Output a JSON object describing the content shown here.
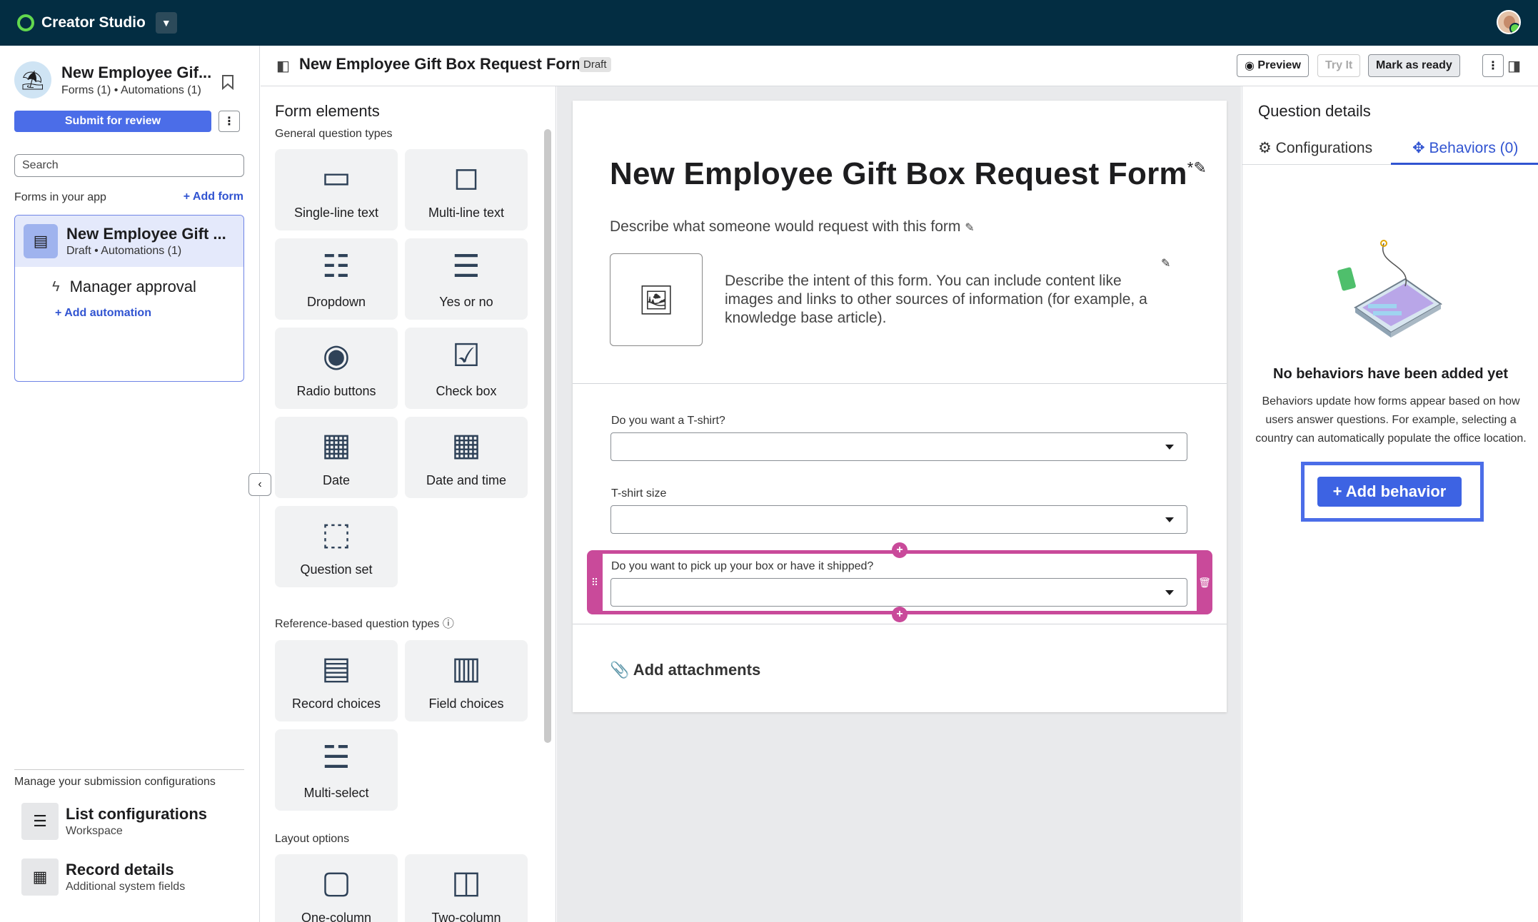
{
  "topbar": {
    "brand": "Creator Studio"
  },
  "app": {
    "title": "New Employee Gif...",
    "subtitle": "Forms (1) • Automations (1)",
    "submit_label": "Submit for review",
    "search_placeholder": "Search",
    "forms_label": "Forms in your app",
    "add_form_label": "+ Add form",
    "form_item": {
      "title": "New Employee Gift ...",
      "subtitle": "Draft • Automations (1)"
    },
    "automation_item": "Manager approval",
    "add_automation_label": "+ Add automation",
    "manage_label": "Manage your submission configurations",
    "configs": [
      {
        "title": "List configurations",
        "subtitle": "Workspace",
        "icon": "list-icon"
      },
      {
        "title": "Record details",
        "subtitle": "Additional system fields",
        "icon": "record-icon"
      }
    ]
  },
  "header": {
    "title": "New Employee Gift Box Request Form",
    "badge": "Draft",
    "preview_label": "Preview",
    "try_it_label": "Try It",
    "mark_ready_label": "Mark as ready",
    "more_label": "⋮"
  },
  "elements_panel": {
    "title": "Form elements",
    "general_label": "General question types",
    "general": [
      "Single-line text",
      "Multi-line text",
      "Dropdown",
      "Yes or no",
      "Radio buttons",
      "Check box",
      "Date",
      "Date and time",
      "Question set"
    ],
    "reference_label": "Reference-based question types",
    "reference": [
      "Record choices",
      "Field choices",
      "Multi-select"
    ],
    "layout_label": "Layout options",
    "layout": [
      "One-column",
      "Two-column"
    ]
  },
  "form": {
    "title": "New Employee Gift Box Request Form",
    "required_mark": "*",
    "description": "Describe what someone would request with this form",
    "intent": "Describe the intent of this form. You can include content like images and links to other sources of information (for example, a knowledge base article).",
    "questions": [
      {
        "label": "Do you want a T-shirt?"
      },
      {
        "label": "T-shirt size"
      },
      {
        "label": "Do you want to pick up your box or have it shipped?"
      }
    ],
    "attachments_label": "Add attachments"
  },
  "details": {
    "title": "Question details",
    "tabs": [
      "Configurations",
      "Behaviors (0)"
    ],
    "empty_title": "No behaviors have been added yet",
    "empty_desc": "Behaviors update how forms appear based on how users answer questions. For example, selecting a country can automatically populate the office location.",
    "add_behavior_label": "+ Add behavior"
  },
  "colors": {
    "topbar": "#032d42",
    "accent": "#3d63e3",
    "selection": "#c94a9a"
  }
}
